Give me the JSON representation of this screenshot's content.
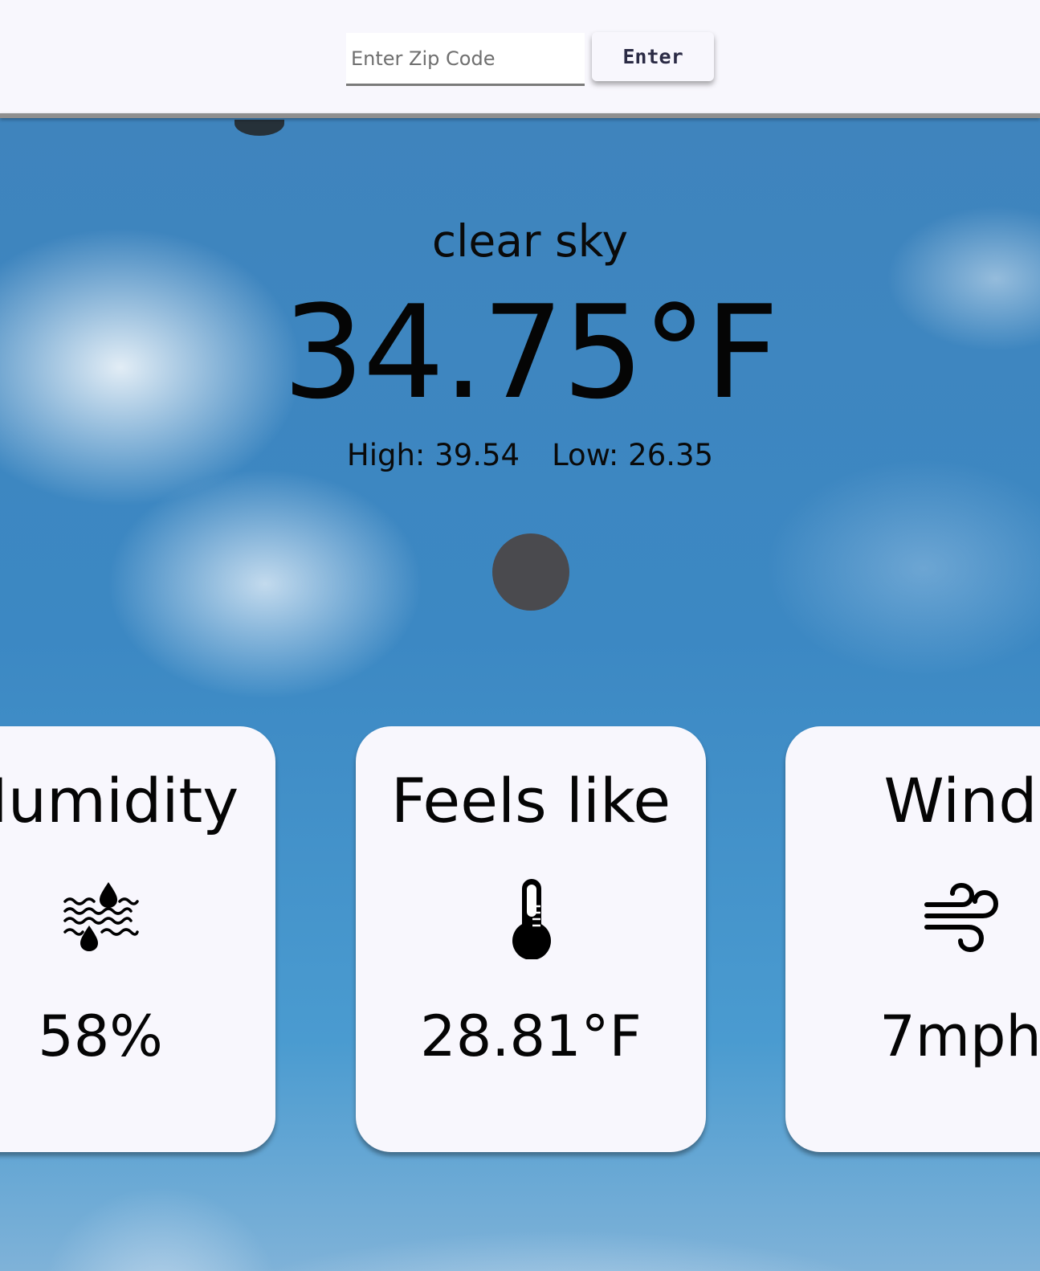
{
  "search": {
    "placeholder": "Enter Zip Code",
    "value": "",
    "button_label": "Enter"
  },
  "current": {
    "description": "clear sky",
    "temperature": "34.75°F",
    "high": "High: 39.54",
    "low": "Low: 26.35",
    "icon": "weather-condition-icon"
  },
  "cards": {
    "humidity": {
      "title": "Humidity",
      "icon": "humidity-icon",
      "value": "58%"
    },
    "feels_like": {
      "title": "Feels like",
      "icon": "thermometer-icon",
      "value": "28.81°F"
    },
    "wind": {
      "title": "Wind",
      "icon": "wind-icon",
      "value": "7mph"
    }
  },
  "colors": {
    "topbar_bg": "#f8f7fd",
    "card_bg": "#f8f7fd",
    "sky": "#3c88c3",
    "weather_icon_placeholder": "#4a4a4e",
    "text": "#050505"
  }
}
